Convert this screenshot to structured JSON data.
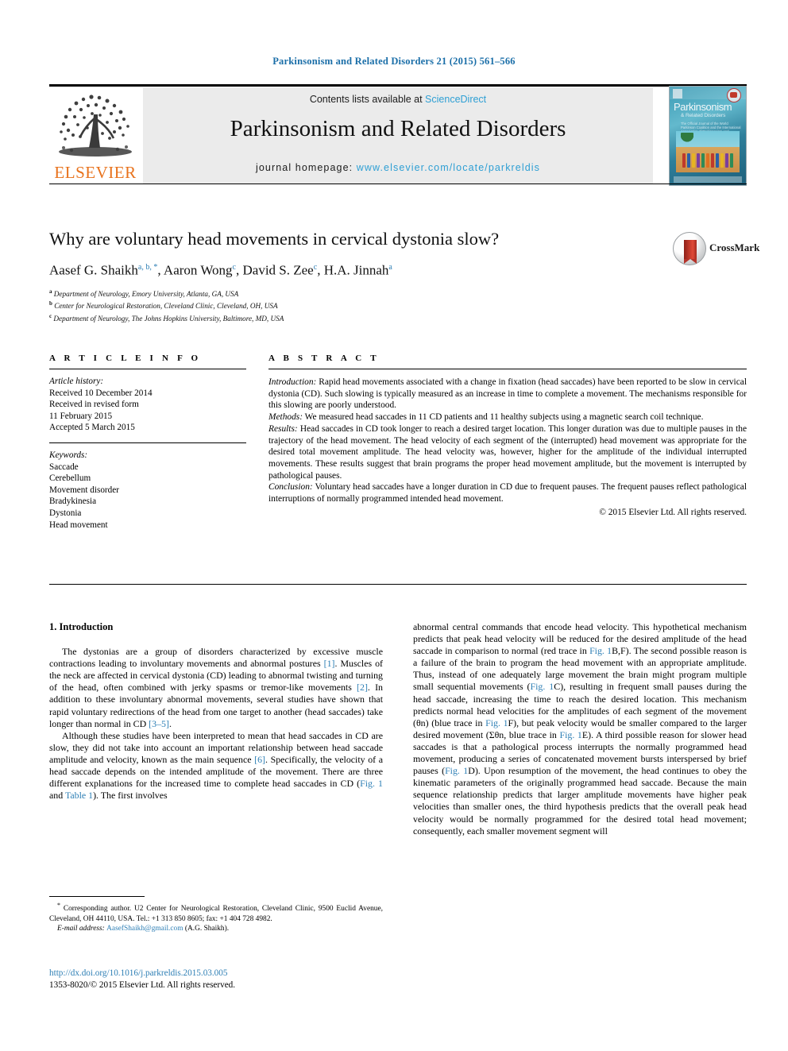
{
  "running_head": "Parkinsonism and Related Disorders 21 (2015) 561–566",
  "masthead": {
    "publisher_name": "ELSEVIER",
    "publisher_logo_icon": "elsevier-tree-icon",
    "contents_prefix": "Contents lists available at ",
    "contents_link": "ScienceDirect",
    "journal_title": "Parkinsonism and Related Disorders",
    "homepage_prefix": "journal homepage: ",
    "homepage_url": "www.elsevier.com/locate/parkreldis",
    "cover": {
      "title": "Parkinsonism",
      "subtitle": "& Related Disorders",
      "blurb": "The Official Journal of the World Parkinson Coalition and the International Association of Parkinsonism and Related Disorders"
    }
  },
  "article": {
    "title": "Why are voluntary head movements in cervical dystonia slow?",
    "authors": [
      {
        "name": "Aasef G. Shaikh",
        "marks": "a, b, *"
      },
      {
        "name": "Aaron Wong",
        "marks": "c"
      },
      {
        "name": "David S. Zee",
        "marks": "c"
      },
      {
        "name": "H.A. Jinnah",
        "marks": "a"
      }
    ],
    "affiliations": [
      {
        "mark": "a",
        "text": "Department of Neurology, Emory University, Atlanta, GA, USA"
      },
      {
        "mark": "b",
        "text": "Center for Neurological Restoration, Cleveland Clinic, Cleveland, OH, USA"
      },
      {
        "mark": "c",
        "text": "Department of Neurology, The Johns Hopkins University, Baltimore, MD, USA"
      }
    ],
    "crossmark_label": "CrossMark"
  },
  "article_info": {
    "heading": "A R T I C L E   I N F O",
    "history_label": "Article history:",
    "history": [
      "Received 10 December 2014",
      "Received in revised form",
      "11 February 2015",
      "Accepted 5 March 2015"
    ],
    "keywords_label": "Keywords:",
    "keywords": [
      "Saccade",
      "Cerebellum",
      "Movement disorder",
      "Bradykinesia",
      "Dystonia",
      "Head movement"
    ]
  },
  "abstract": {
    "heading": "A B S T R A C T",
    "sections": [
      {
        "label": "Introduction:",
        "text": " Rapid head movements associated with a change in fixation (head saccades) have been reported to be slow in cervical dystonia (CD). Such slowing is typically measured as an increase in time to complete a movement. The mechanisms responsible for this slowing are poorly understood."
      },
      {
        "label": "Methods:",
        "text": " We measured head saccades in 11 CD patients and 11 healthy subjects using a magnetic search coil technique."
      },
      {
        "label": "Results:",
        "text": " Head saccades in CD took longer to reach a desired target location. This longer duration was due to multiple pauses in the trajectory of the head movement. The head velocity of each segment of the (interrupted) head movement was appropriate for the desired total movement amplitude. The head velocity was, however, higher for the amplitude of the individual interrupted movements. These results suggest that brain programs the proper head movement amplitude, but the movement is interrupted by pathological pauses."
      },
      {
        "label": "Conclusion:",
        "text": " Voluntary head saccades have a longer duration in CD due to frequent pauses. The frequent pauses reflect pathological interruptions of normally programmed intended head movement."
      }
    ],
    "copyright": "© 2015 Elsevier Ltd. All rights reserved."
  },
  "body": {
    "section_heading": "1. Introduction",
    "left_paragraphs": [
      {
        "parts": [
          {
            "t": "The dystonias are a group of disorders characterized by excessive muscle contractions leading to involuntary movements and abnormal postures "
          },
          {
            "t": "[1]",
            "ref": true
          },
          {
            "t": ". Muscles of the neck are affected in cervical dystonia (CD) leading to abnormal twisting and turning of the head, often combined with jerky spasms or tremor-like movements "
          },
          {
            "t": "[2]",
            "ref": true
          },
          {
            "t": ". In addition to these involuntary abnormal movements, several studies have shown that rapid voluntary redirections of the head from one target to another (head saccades) take longer than normal in CD "
          },
          {
            "t": "[3–5]",
            "ref": true
          },
          {
            "t": "."
          }
        ]
      },
      {
        "parts": [
          {
            "t": "Although these studies have been interpreted to mean that head saccades in CD are slow, they did not take into account an important relationship between head saccade amplitude and velocity, known as the main sequence "
          },
          {
            "t": "[6]",
            "ref": true
          },
          {
            "t": ". Specifically, the velocity of a head saccade depends on the intended amplitude of the movement. There are three different explanations for the increased time to complete head saccades in CD ("
          },
          {
            "t": "Fig. 1",
            "ref": true
          },
          {
            "t": " and "
          },
          {
            "t": "Table 1",
            "ref": true
          },
          {
            "t": "). The first involves"
          }
        ]
      }
    ],
    "right_paragraphs": [
      {
        "parts": [
          {
            "t": "abnormal central commands that encode head velocity. This hypothetical mechanism predicts that peak head velocity will be reduced for the desired amplitude of the head saccade in comparison to normal (red trace in "
          },
          {
            "t": "Fig. 1",
            "ref": true
          },
          {
            "t": "B,F). The second possible reason is a failure of the brain to program the head movement with an appropriate amplitude. Thus, instead of one adequately large movement the brain might program multiple small sequential movements ("
          },
          {
            "t": "Fig. 1",
            "ref": true
          },
          {
            "t": "C), resulting in frequent small pauses during the head saccade, increasing the time to reach the desired location. This mechanism predicts normal head velocities for the amplitudes of each segment of the movement (θn) (blue trace in "
          },
          {
            "t": "Fig. 1",
            "ref": true
          },
          {
            "t": "F), but peak velocity would be smaller compared to the larger desired movement (Σθn, blue trace in "
          },
          {
            "t": "Fig. 1",
            "ref": true
          },
          {
            "t": "E). A third possible reason for slower head saccades is that a pathological process interrupts the normally programmed head movement, producing a series of concatenated movement bursts interspersed by brief pauses ("
          },
          {
            "t": "Fig. 1",
            "ref": true
          },
          {
            "t": "D). Upon resumption of the movement, the head continues to obey the kinematic parameters of the originally programmed head saccade. Because the main sequence relationship predicts that larger amplitude movements have higher peak velocities than smaller ones, the third hypothesis predicts that the overall peak head velocity would be normally programmed for the desired total head movement; consequently, each smaller movement segment will"
          }
        ]
      }
    ]
  },
  "footnote": {
    "marker": "*",
    "text": " Corresponding author. U2 Center for Neurological Restoration, Cleveland Clinic, 9500 Euclid Avenue, Cleveland, OH 44110, USA. Tel.: +1 313 850 8605; fax: +1 404 728 4982.",
    "email_label": "E-mail address:",
    "email": "AasefShaikh@gmail.com",
    "email_owner": " (A.G. Shaikh)."
  },
  "doi": {
    "url": "http://dx.doi.org/10.1016/j.parkreldis.2015.03.005",
    "issn_line": "1353-8020/© 2015 Elsevier Ltd. All rights reserved."
  },
  "colors": {
    "link_blue": "#2e7fb5",
    "sciencedirect_blue": "#2e9fd4",
    "elsevier_orange": "#e8721c",
    "crossmark_red": "#c0392b"
  }
}
